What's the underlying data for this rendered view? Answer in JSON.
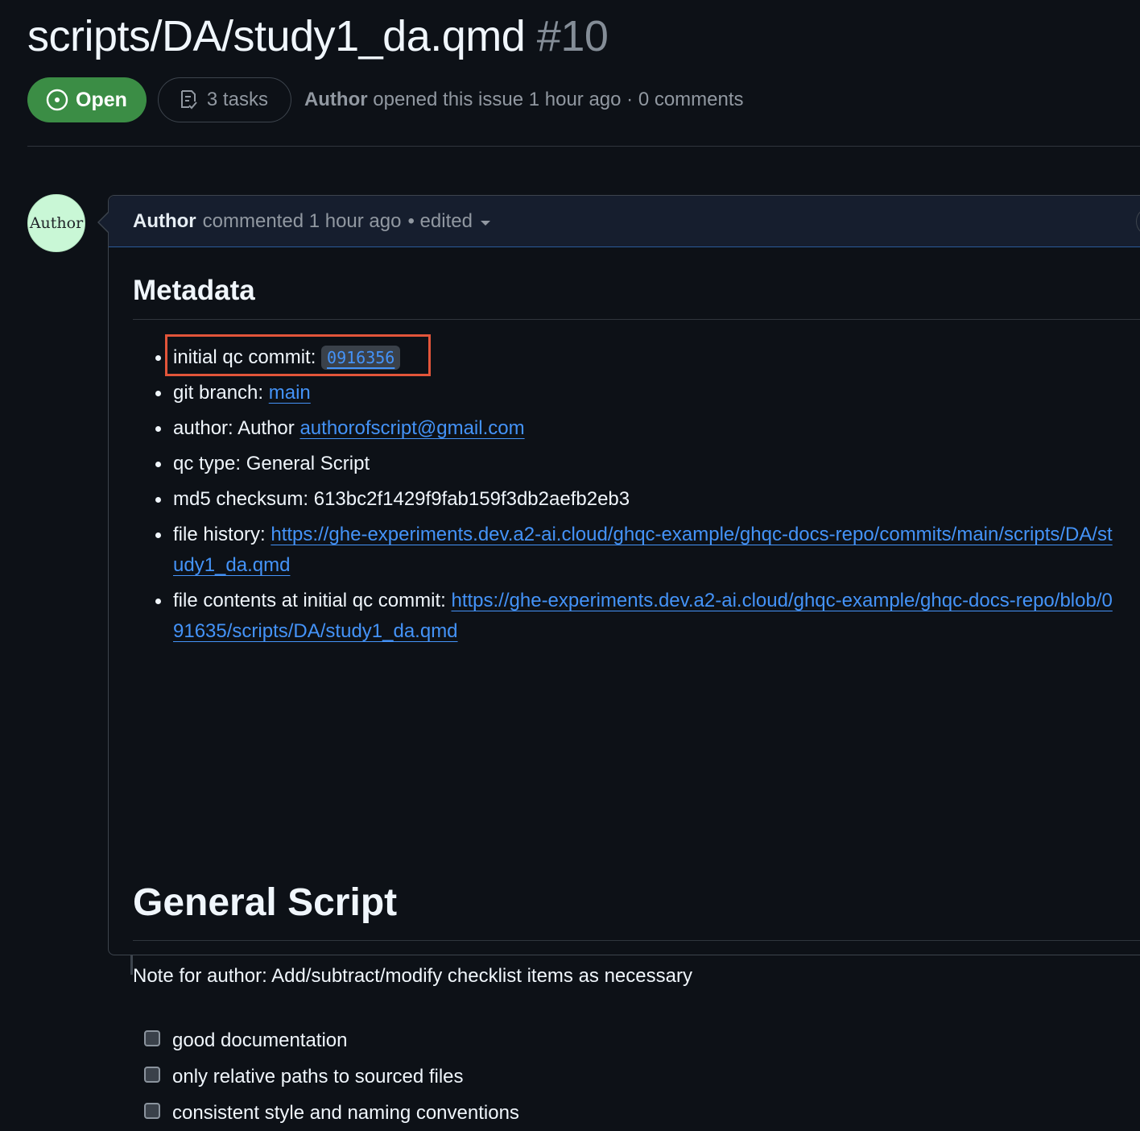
{
  "issue": {
    "title": "scripts/DA/study1_da.qmd",
    "number": "#10",
    "state": "Open",
    "tasks_label": "3 tasks",
    "opened_author": "Author",
    "opened_text": "opened this issue 1 hour ago · 0 comments"
  },
  "comment": {
    "avatar_text": "Author",
    "author": "Author",
    "action": "commented 1 hour ago",
    "edited": "• edited",
    "metadata_heading": "Metadata",
    "meta": {
      "commit_label": "initial qc commit:",
      "commit_sha": "0916356",
      "branch_label": "git branch:",
      "branch": "main",
      "author_label": "author: Author",
      "author_email": "authorofscript@gmail.com",
      "qc_type": "qc type: General Script",
      "md5": "md5 checksum: 613bc2f1429f9fab159f3db2aefb2eb3",
      "history_label": "file history:",
      "history_url": "https://ghe-experiments.dev.a2-ai.cloud/ghqc-example/ghqc-docs-repo/commits/main/scripts/DA/study1_da.qmd",
      "contents_label": "file contents at initial qc commit:",
      "contents_url": "https://ghe-experiments.dev.a2-ai.cloud/ghqc-example/ghqc-docs-repo/blob/091635/scripts/DA/study1_da.qmd"
    },
    "section_heading": "General Script",
    "note": "Note for author: Add/subtract/modify checklist items as necessary",
    "checklist": [
      {
        "label": "good documentation",
        "checked": false
      },
      {
        "label": "only relative paths to sourced files",
        "checked": false
      },
      {
        "label": "consistent style and naming conventions",
        "checked": false
      }
    ]
  },
  "colors": {
    "open_badge": "#3b8d45",
    "link": "#4493f8",
    "highlight_box": "#e2553a",
    "avatar_bg": "#c9f7d6"
  }
}
